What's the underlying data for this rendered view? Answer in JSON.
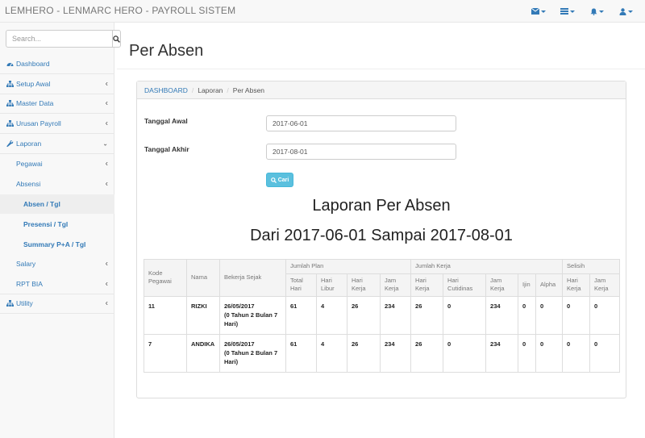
{
  "navbar": {
    "brand": "LEMHERO - LENMARC HERO - PAYROLL SISTEM",
    "icons": [
      "envelope-icon",
      "tasks-icon",
      "bell-icon",
      "user-icon"
    ]
  },
  "sidebar": {
    "search_placeholder": "Search...",
    "items": [
      {
        "label": "Dashboard",
        "icon": "dashboard-icon"
      },
      {
        "label": "Setup Awal",
        "icon": "sitemap-icon"
      },
      {
        "label": "Master Data",
        "icon": "sitemap-icon"
      },
      {
        "label": "Urusan Payroll",
        "icon": "sitemap-icon"
      },
      {
        "label": "Laporan",
        "icon": "wrench-icon"
      },
      {
        "label": "Pegawai"
      },
      {
        "label": "Absensi"
      },
      {
        "label": "Absen / Tgl"
      },
      {
        "label": "Presensi / Tgl"
      },
      {
        "label": "Summary P+A / Tgl"
      },
      {
        "label": "Salary"
      },
      {
        "label": "RPT BIA"
      },
      {
        "label": "Utility",
        "icon": "sitemap-icon"
      }
    ]
  },
  "page": {
    "title": "Per Absen"
  },
  "breadcrumb": [
    "DASHBOARD",
    "Laporan",
    "Per Absen"
  ],
  "form": {
    "tanggal_awal_label": "Tanggal Awal",
    "tanggal_awal_value": "2017-06-01",
    "tanggal_akhir_label": "Tanggal Akhir",
    "tanggal_akhir_value": "2017-08-01",
    "cari_label": "Cari"
  },
  "report": {
    "title": "Laporan Per Absen",
    "subtitle": "Dari 2017-06-01 Sampai 2017-08-01",
    "headers": {
      "kode": "Kode Pegawai",
      "nama": "Nama",
      "bekerja": "Bekerja Sejak",
      "jumlah_plan": "Jumlah Plan",
      "jumlah_kerja": "Jumlah Kerja",
      "selisih": "Selisih",
      "total_hari": "Total Hari",
      "hari_libur": "Hari Libur",
      "hari_kerja": "Hari Kerja",
      "jam_kerja": "Jam Kerja",
      "hari_kerja2": "Hari Kerja",
      "hari_cutidinas": "Hari Cutidinas",
      "jam_kerja2": "Jam Kerja",
      "ijin": "Ijin",
      "alpha": "Alpha",
      "sel_hari_kerja": "Hari Kerja",
      "sel_jam_kerja": "Jam Kerja"
    },
    "rows": [
      {
        "kode": "11",
        "nama": "RIZKI",
        "bekerja_tgl": "26/05/2017",
        "bekerja_lama": "(0 Tahun 2 Bulan 7 Hari)",
        "total_hari": "61",
        "hari_libur": "4",
        "hari_kerja": "26",
        "jam_kerja": "234",
        "k_hari_kerja": "26",
        "k_cutidinas": "0",
        "k_jam_kerja": "234",
        "ijin": "0",
        "alpha": "0",
        "s_hari_kerja": "0",
        "s_jam_kerja": "0"
      },
      {
        "kode": "7",
        "nama": "ANDIKA",
        "bekerja_tgl": "26/05/2017",
        "bekerja_lama": "(0 Tahun 2 Bulan 7 Hari)",
        "total_hari": "61",
        "hari_libur": "4",
        "hari_kerja": "26",
        "jam_kerja": "234",
        "k_hari_kerja": "26",
        "k_cutidinas": "0",
        "k_jam_kerja": "234",
        "ijin": "0",
        "alpha": "0",
        "s_hari_kerja": "0",
        "s_jam_kerja": "0"
      }
    ]
  }
}
